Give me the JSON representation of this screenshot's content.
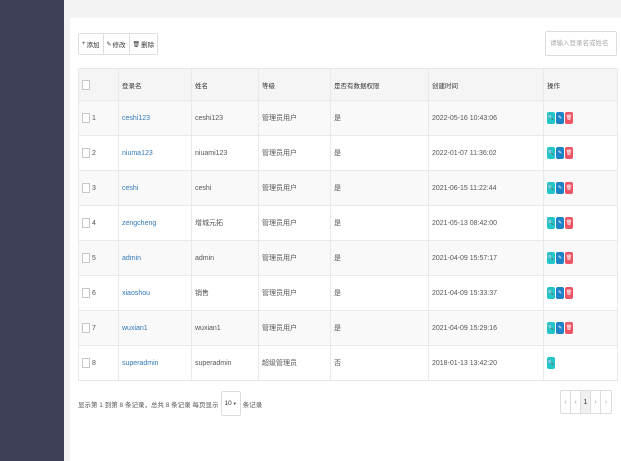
{
  "toolbar": {
    "add_label": "添加",
    "edit_label": "修改",
    "delete_label": "删除"
  },
  "search": {
    "placeholder": "请输入登录名或姓名"
  },
  "table": {
    "headers": [
      "登录名",
      "姓名",
      "等级",
      "是否有数据权限",
      "创建时间",
      "操作"
    ],
    "rows": [
      {
        "no": "1",
        "login": "ceshi123",
        "name": "ceshi123",
        "level": "管理员用户",
        "perm": "是",
        "created": "2022-05-16 10:43:06",
        "actions": [
          "view",
          "edit",
          "delete"
        ]
      },
      {
        "no": "2",
        "login": "niuma123",
        "name": "niuami123",
        "level": "管理员用户",
        "perm": "是",
        "created": "2022-01-07 11:36:02",
        "actions": [
          "view",
          "edit",
          "delete"
        ]
      },
      {
        "no": "3",
        "login": "ceshi",
        "name": "ceshi",
        "level": "管理员用户",
        "perm": "是",
        "created": "2021-06-15 11:22:44",
        "actions": [
          "view",
          "edit",
          "delete"
        ]
      },
      {
        "no": "4",
        "login": "zengcheng",
        "name": "增城元拓",
        "level": "管理员用户",
        "perm": "是",
        "created": "2021-05-13 08:42:00",
        "actions": [
          "view",
          "edit",
          "delete"
        ]
      },
      {
        "no": "5",
        "login": "admin",
        "name": "admin",
        "level": "管理员用户",
        "perm": "是",
        "created": "2021-04-09 15:57:17",
        "actions": [
          "view",
          "edit",
          "delete"
        ]
      },
      {
        "no": "6",
        "login": "xiaoshou",
        "name": "销售",
        "level": "管理员用户",
        "perm": "是",
        "created": "2021-04-09 15:33:37",
        "actions": [
          "view",
          "edit",
          "delete"
        ]
      },
      {
        "no": "7",
        "login": "wuxian1",
        "name": "wuxian1",
        "level": "管理员用户",
        "perm": "是",
        "created": "2021-04-09 15:29:16",
        "actions": [
          "view",
          "edit",
          "delete"
        ]
      },
      {
        "no": "8",
        "login": "superadmin",
        "name": "superadmin",
        "level": "超级管理员",
        "perm": "否",
        "created": "2018-01-13 13:42:20",
        "actions": [
          "view"
        ]
      }
    ]
  },
  "footer": {
    "info_prefix": "显示第 1 到第 8 条记录，总共 8 条记录 每页显示",
    "page_size": "10",
    "info_suffix": "条记录"
  },
  "pagination": {
    "first": "‹",
    "prev": "‹",
    "current": "1",
    "next": "›",
    "last": "›"
  },
  "colors": {
    "sidebar": "#3e4058",
    "view": "#23c6c8",
    "edit": "#1c84c6",
    "delete": "#ed5565",
    "link": "#337ab7"
  }
}
